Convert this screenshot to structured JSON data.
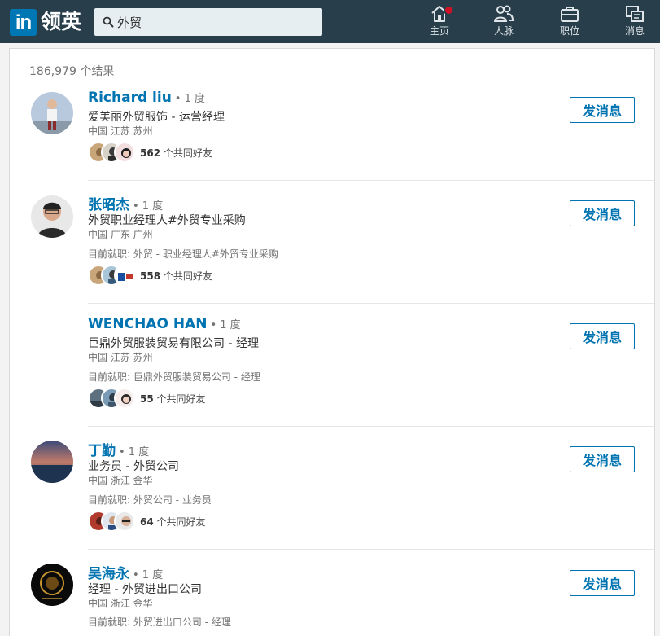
{
  "app": {
    "logo_mark": "in",
    "logo_text": "领英"
  },
  "search": {
    "value": "外贸",
    "placeholder": ""
  },
  "nav": [
    {
      "label": "主页",
      "icon": "home-icon",
      "has_badge": true
    },
    {
      "label": "人脉",
      "icon": "network-icon",
      "has_badge": false
    },
    {
      "label": "职位",
      "icon": "jobs-icon",
      "has_badge": false
    },
    {
      "label": "消息",
      "icon": "messages-icon",
      "has_badge": false
    }
  ],
  "results_count": "186,979 个结果",
  "results": [
    {
      "name": "Richard liu",
      "degree": "• 1 度",
      "headline": "爱美丽外贸服饰 - 运营经理",
      "location": "中国 江苏 苏州",
      "current": "",
      "mutual_count": "562",
      "mutual_suffix": " 个共同好友",
      "button": "发消息",
      "has_avatar": true
    },
    {
      "name": "张昭杰",
      "degree": "• 1 度",
      "headline": "外贸职业经理人#外贸专业采购",
      "location": "中国 广东 广州",
      "current": "目前就职: 外贸 - 职业经理人#外贸专业采购",
      "mutual_count": "558",
      "mutual_suffix": " 个共同好友",
      "button": "发消息",
      "has_avatar": true
    },
    {
      "name": "WENCHAO HAN",
      "degree": "• 1 度",
      "headline": "巨鼎外贸服装贸易有限公司 - 经理",
      "location": "中国 江苏 苏州",
      "current": "目前就职: 巨鼎外贸服装贸易公司 - 经理",
      "mutual_count": "55",
      "mutual_suffix": " 个共同好友",
      "button": "发消息",
      "has_avatar": false
    },
    {
      "name": "丁勤",
      "degree": "• 1 度",
      "headline": "业务员 - 外贸公司",
      "location": "中国 浙江 金华",
      "current": "目前就职: 外贸公司 - 业务员",
      "mutual_count": "64",
      "mutual_suffix": " 个共同好友",
      "button": "发消息",
      "has_avatar": true
    },
    {
      "name": "吴海永",
      "degree": "• 1 度",
      "headline": "经理 - 外贸进出口公司",
      "location": "中国 浙江 金华",
      "current": "目前就职: 外贸进出口公司 - 经理",
      "mutual_count": "",
      "mutual_suffix": "",
      "button": "发消息",
      "has_avatar": true
    }
  ],
  "colors": {
    "topbar": "#283e4a",
    "brand": "#0077b5",
    "link": "#0073b1",
    "badge": "#d11124"
  }
}
